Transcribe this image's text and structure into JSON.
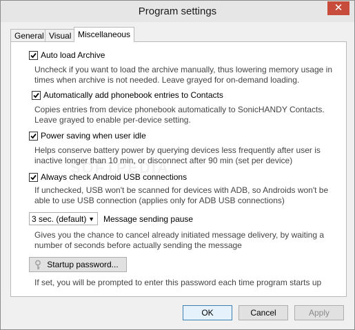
{
  "window": {
    "title": "Program settings",
    "close_symbol": "✕"
  },
  "tabs": [
    {
      "label": "General"
    },
    {
      "label": "Visual"
    },
    {
      "label": "Miscellaneous",
      "active": true
    }
  ],
  "options": [
    {
      "label": "Auto load Archive",
      "checked": true,
      "desc": "Uncheck if you want to load the archive manually, thus lowering memory usage in times when archive is not needed. Leave grayed for on-demand loading."
    },
    {
      "label": "Automatically add phonebook entries to Contacts",
      "checked": true,
      "desc": "Copies entries from device phonebook automatically to SonicHANDY Contacts. Leave grayed to enable per-device setting."
    },
    {
      "label": "Power saving when user idle",
      "checked": true,
      "desc": "Helps conserve battery power by querying devices less frequently after user is inactive longer than 10 min, or disconnect after 90 min (set per device)"
    },
    {
      "label": "Always check Android USB connections",
      "checked": true,
      "desc": "If unchecked, USB won't be scanned for devices with ADB, so Androids won't be able to use USB connection (applies only for ADB USB connections)"
    }
  ],
  "pause": {
    "selected": "3 sec. (default)",
    "label": "Message sending pause",
    "desc": "Gives you the chance to cancel already initiated message delivery, by waiting a number of seconds before actually sending the message"
  },
  "password": {
    "button_label": "Startup password...",
    "desc": "If set, you will be prompted to enter this password each time program starts up"
  },
  "footer": {
    "ok": "OK",
    "cancel": "Cancel",
    "apply": "Apply"
  },
  "colors": {
    "close": "#c74c3c",
    "primary_border": "#3c7fb1"
  }
}
